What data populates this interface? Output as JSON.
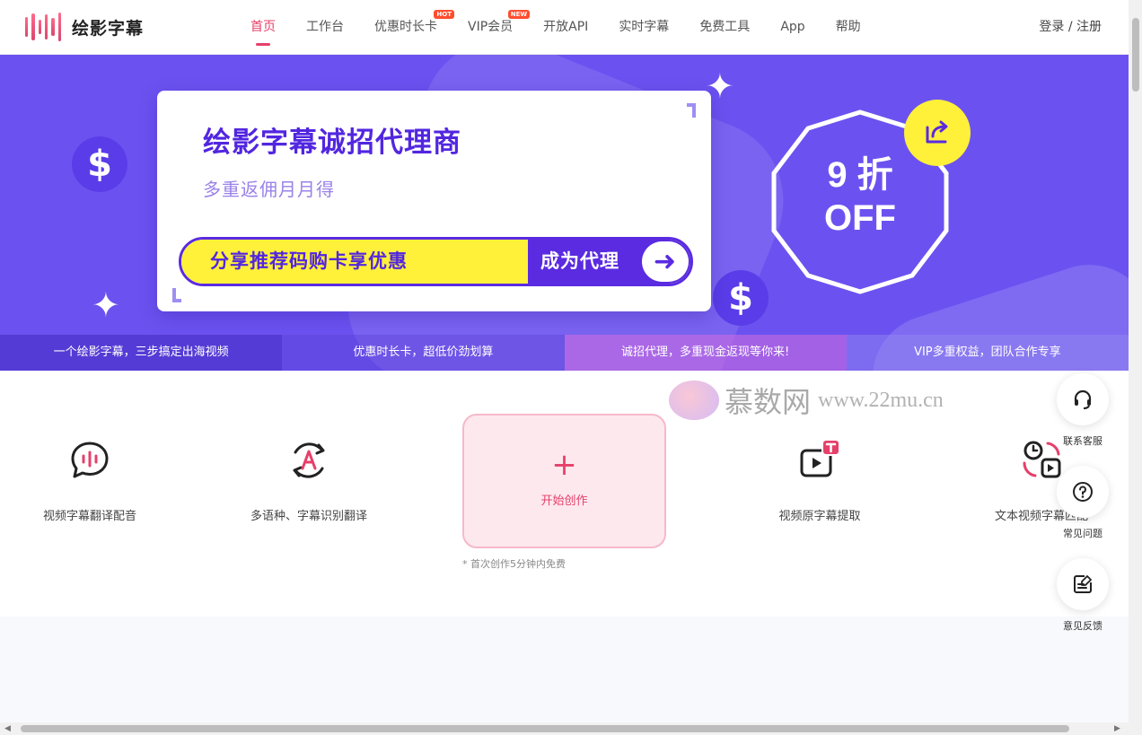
{
  "header": {
    "logo_text": "绘影字幕",
    "nav": [
      {
        "label": "首页",
        "active": true
      },
      {
        "label": "工作台"
      },
      {
        "label": "优惠时长卡",
        "badge": "HOT"
      },
      {
        "label": "VIP会员",
        "badge": "NEW"
      },
      {
        "label": "开放API"
      },
      {
        "label": "实时字幕"
      },
      {
        "label": "免费工具"
      },
      {
        "label": "App"
      },
      {
        "label": "帮助"
      }
    ],
    "login": "登录 / 注册"
  },
  "banner": {
    "title": "绘影字幕诚招代理商",
    "subtitle": "多重返佣月月得",
    "pill_left": "分享推荐码购卡享优惠",
    "pill_right": "成为代理",
    "discount_line1": "9 折",
    "discount_line2": "OFF",
    "dollar": "$"
  },
  "tabs": [
    "一个绘影字幕，三步搞定出海视频",
    "优惠时长卡，超低价劲划算",
    "诚招代理，多重现金返现等你来!",
    "VIP多重权益，团队合作专享"
  ],
  "features": {
    "items": [
      {
        "label": "视频字幕翻译配音",
        "icon": "voice-chat-icon"
      },
      {
        "label": "多语种、字幕识别翻译",
        "icon": "language-rotate-icon"
      },
      {
        "label": "视频原字幕提取",
        "icon": "video-text-icon"
      },
      {
        "label": "文本视频字幕匹配",
        "icon": "text-video-sync-icon"
      }
    ],
    "create_label": "开始创作",
    "create_plus": "+",
    "create_note": "* 首次创作5分钟内免费"
  },
  "watermark": {
    "cn": "慕数网",
    "url": "www.22mu.cn"
  },
  "float_buttons": [
    {
      "label": "联系客服",
      "icon": "headset-icon"
    },
    {
      "label": "常见问题",
      "icon": "question-icon"
    },
    {
      "label": "意见反馈",
      "icon": "feedback-icon"
    }
  ],
  "colors": {
    "accent": "#e5406a",
    "banner": "#6b52f0",
    "purple": "#5a2be0",
    "yellow": "#fff03a"
  }
}
